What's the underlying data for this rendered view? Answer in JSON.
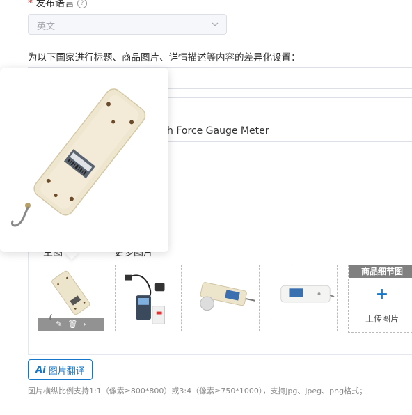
{
  "publish_language": {
    "label": "发布语言",
    "required_mark": "*",
    "help_icon": "question-circle-icon",
    "selected": "英文"
  },
  "differentiation_label": "为以下国家进行标题、商品图片、详情描述等内容的差异化设置：",
  "title_field": {
    "visible_value": "h Force Gauge Meter"
  },
  "image_tabs": {
    "main": "主图",
    "more": "更多图片"
  },
  "images": [
    {
      "name": "main-image",
      "tools": [
        "edit-icon",
        "delete-icon",
        "next-icon"
      ]
    },
    {
      "name": "kit-image"
    },
    {
      "name": "gauge-side-image"
    },
    {
      "name": "gauge-front-image"
    }
  ],
  "detail_image": {
    "title": "商品细节图",
    "plus": "+",
    "upload_label": "上传图片"
  },
  "translate_button": {
    "ai_label": "Ai",
    "label": "图片翻译"
  },
  "hint": "图片横纵比例支持1:1（像素≥800*800）或3:4（像素≥750*1000），支持jpg、jpeg、png格式；",
  "colors": {
    "accent": "#1677c9",
    "required": "#e53935",
    "border": "#dcdfe6"
  }
}
